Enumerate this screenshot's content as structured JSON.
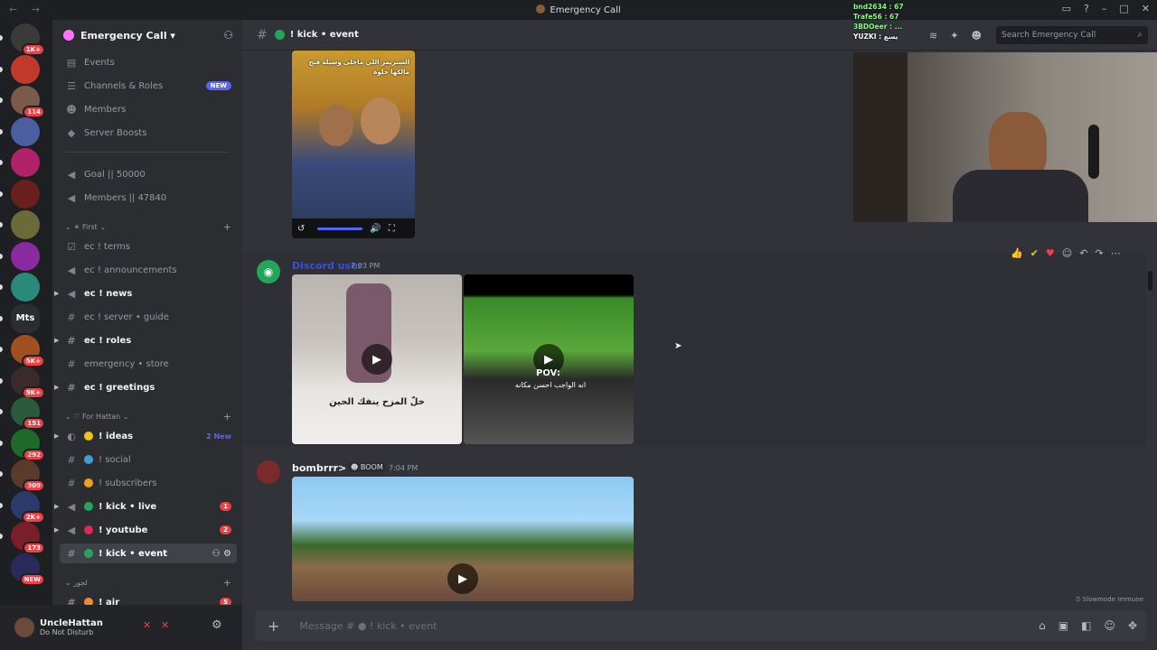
{
  "window": {
    "title": "Emergency Call",
    "nav": "← →"
  },
  "server": {
    "name": "Emergency Call ▾"
  },
  "rail": {
    "items": [
      {
        "badge": "1K+",
        "color": "#3a3a3a"
      },
      {
        "badge": "",
        "color": "#c0392b"
      },
      {
        "badge": "114",
        "color": "#7a5a48"
      },
      {
        "badge": "",
        "color": "#4a5fa0"
      },
      {
        "badge": "",
        "color": "#b0226a"
      },
      {
        "badge": "",
        "color": "#6a1e1e"
      },
      {
        "badge": "",
        "color": "#6b6b3a"
      },
      {
        "badge": "",
        "color": "#8a2aa0"
      },
      {
        "badge": "",
        "color": "#2a8a7a"
      },
      {
        "label": "Mts",
        "badge": "",
        "color": "#2b2d31"
      },
      {
        "badge": "5K+",
        "color": "#a0501e"
      },
      {
        "badge": "9K+",
        "color": "#3a2a2a"
      },
      {
        "badge": "151",
        "color": "#2a5a3a"
      },
      {
        "badge": "292",
        "color": "#1e6a2a"
      },
      {
        "badge": "309",
        "color": "#5a3a2a"
      },
      {
        "badge": "2K+",
        "color": "#2a3a6a"
      },
      {
        "badge": "173",
        "color": "#7a1e2a"
      },
      {
        "badge": "NEW",
        "color": "#2a2a5a"
      }
    ]
  },
  "sidebar": {
    "top_items": [
      {
        "icon": "calendar-icon",
        "glyph": "▤",
        "label": "Events"
      },
      {
        "icon": "list-icon",
        "glyph": "☰",
        "label": "Channels & Roles",
        "new": "NEW"
      },
      {
        "icon": "members-icon",
        "glyph": "☻",
        "label": "Members"
      },
      {
        "icon": "boost-icon",
        "glyph": "◆",
        "label": "Server Boosts"
      }
    ],
    "stat_channels": [
      {
        "label": "Goal || 50000"
      },
      {
        "label": "Members || 47840"
      }
    ],
    "category1": "⌄ ☀ First ⌄",
    "cat1_items": [
      {
        "glyph": "☑",
        "label": "ec ! terms",
        "bright": false
      },
      {
        "glyph": "◀",
        "label": "ec ! announcements",
        "bright": false
      },
      {
        "glyph": "◀",
        "label": "ec ! news",
        "bright": true
      },
      {
        "glyph": "#",
        "label": "ec ! server • guide",
        "bright": false
      },
      {
        "glyph": "#",
        "label": "ec ! roles",
        "bright": true
      },
      {
        "glyph": "#",
        "label": "emergency • store",
        "bright": false
      },
      {
        "glyph": "#",
        "label": "ec ! greetings",
        "bright": true
      }
    ],
    "category2": "⌄ ♡ For Hattan ⌄",
    "cat2_items": [
      {
        "glyph": "◐",
        "emoji": "#f0c419",
        "label": "! ideas",
        "bright": true,
        "count2": "2 New"
      },
      {
        "glyph": "#",
        "emoji": "#3ba0d0",
        "label": "! social",
        "bright": false
      },
      {
        "glyph": "#",
        "emoji": "#f0a020",
        "label": "! subscribers",
        "bright": false
      },
      {
        "glyph": "◀",
        "emoji": "#23a55a",
        "label": "! kick • live",
        "bright": true,
        "count": "1"
      },
      {
        "glyph": "◀",
        "emoji": "#e0245e",
        "label": "! youtube",
        "bright": true,
        "count": "2"
      },
      {
        "glyph": "#",
        "emoji": "#23a55a",
        "label": "! kick • event",
        "bright": true,
        "selected": true
      }
    ],
    "category3": "⌄ لجور",
    "cat3_items": [
      {
        "glyph": "#",
        "emoji": "#f08a30",
        "label": "! ajr",
        "bright": true,
        "count": "5"
      }
    ]
  },
  "user": {
    "name": "UncleHattan",
    "status": "Do Not Disturb"
  },
  "channel": {
    "name": "! kick • event"
  },
  "search": {
    "placeholder": "Search Emergency Call"
  },
  "messages": [
    {
      "author": "Discord user",
      "time": "7:03 PM"
    },
    {
      "author": "bombrrr>",
      "tag": "☻ BOOM",
      "time": "7:04 PM"
    }
  ],
  "composer": {
    "placeholder": "Message # ● ! kick • event"
  },
  "slowmode": "⏱ Slowmode Immune",
  "media": {
    "top_caption": "الستريمر اللي ماخلى وسيلة فتح مالكها حلوة",
    "billiards_caption": "خلّ المزح ينفك الحين",
    "pov": "POV:",
    "pov_sub": "انه الواجب احسن مكانه"
  },
  "overlay_chat": [
    {
      "text": "bnd2634 : 67",
      "color": "#7fff7f"
    },
    {
      "text": "Trafe56 : 67",
      "color": "#7fff7f"
    },
    {
      "text": "3BDOeer : ...",
      "color": "#7fff7f"
    },
    {
      "text": "YUZKI : يسع",
      "color": "#ffffff"
    }
  ]
}
